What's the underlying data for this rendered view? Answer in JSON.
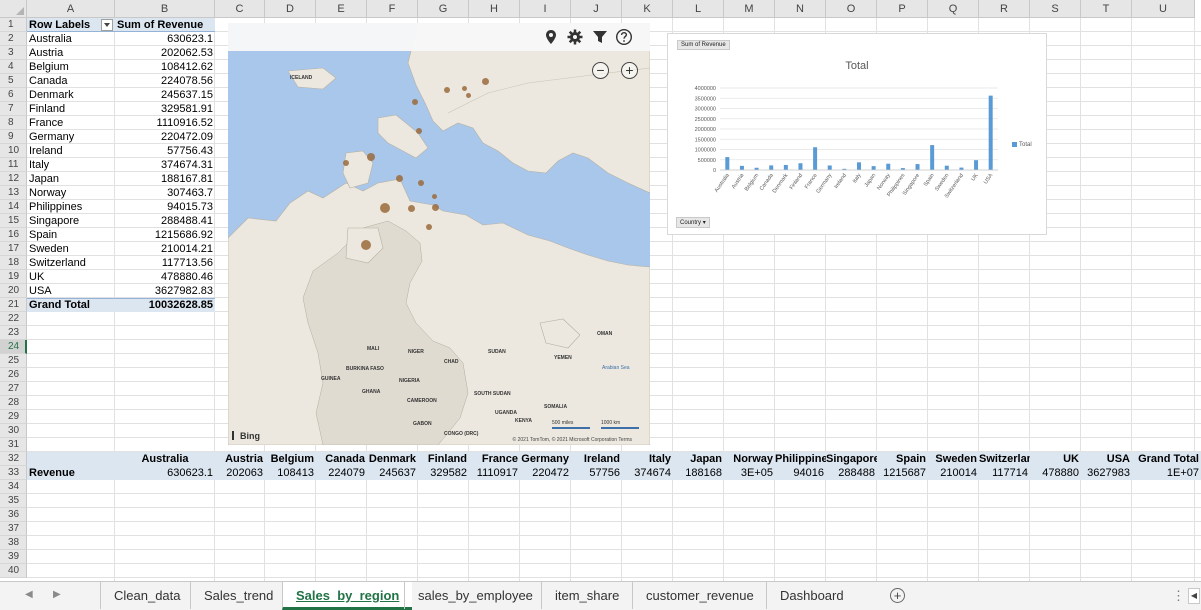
{
  "columns": [
    "A",
    "B",
    "C",
    "D",
    "E",
    "F",
    "G",
    "H",
    "I",
    "J",
    "K",
    "L",
    "M",
    "N",
    "O",
    "P",
    "Q",
    "R",
    "S",
    "T",
    "U"
  ],
  "rows": [
    "1",
    "2",
    "3",
    "4",
    "5",
    "6",
    "7",
    "8",
    "9",
    "10",
    "11",
    "12",
    "13",
    "14",
    "15",
    "16",
    "17",
    "18",
    "19",
    "20",
    "21",
    "22",
    "23",
    "24",
    "25",
    "26",
    "27",
    "28",
    "29",
    "30",
    "31",
    "32",
    "33",
    "34",
    "35",
    "36",
    "37",
    "38",
    "39",
    "40"
  ],
  "active_row": "24",
  "pivot": {
    "row_labels_header": "Row Labels",
    "sum_header": "Sum of Revenue",
    "rows": [
      {
        "label": "Australia",
        "value": "630623.1"
      },
      {
        "label": "Austria",
        "value": "202062.53"
      },
      {
        "label": "Belgium",
        "value": "108412.62"
      },
      {
        "label": "Canada",
        "value": "224078.56"
      },
      {
        "label": "Denmark",
        "value": "245637.15"
      },
      {
        "label": "Finland",
        "value": "329581.91"
      },
      {
        "label": "France",
        "value": "1110916.52"
      },
      {
        "label": "Germany",
        "value": "220472.09"
      },
      {
        "label": "Ireland",
        "value": "57756.43"
      },
      {
        "label": "Italy",
        "value": "374674.31"
      },
      {
        "label": "Japan",
        "value": "188167.81"
      },
      {
        "label": "Norway",
        "value": "307463.7"
      },
      {
        "label": "Philippines",
        "value": "94015.73"
      },
      {
        "label": "Singapore",
        "value": "288488.41"
      },
      {
        "label": "Spain",
        "value": "1215686.92"
      },
      {
        "label": "Sweden",
        "value": "210014.21"
      },
      {
        "label": "Switzerland",
        "value": "117713.56"
      },
      {
        "label": "UK",
        "value": "478880.46"
      },
      {
        "label": "USA",
        "value": "3627982.83"
      }
    ],
    "grand_total_label": "Grand Total",
    "grand_total_value": "10032628.85"
  },
  "horizontal_table": {
    "row_label": "Revenue",
    "headers": [
      "Australia",
      "Austria",
      "Belgium",
      "Canada",
      "Denmark",
      "Finland",
      "France",
      "Germany",
      "Ireland",
      "Italy",
      "Japan",
      "Norway",
      "Philippines",
      "Singapore",
      "Spain",
      "Sweden",
      "Switzerland",
      "UK",
      "USA",
      "Grand Total"
    ],
    "values": [
      "630623.1",
      "202063",
      "108413",
      "224079",
      "245637",
      "329582",
      "1110917",
      "220472",
      "57756",
      "374674",
      "188168",
      "3E+05",
      "94016",
      "288488",
      "1215687",
      "210014",
      "117714",
      "478880",
      "3627983",
      "1E+07"
    ]
  },
  "map": {
    "labels": [
      {
        "text": "ICELAND",
        "id": "iceland"
      },
      {
        "text": "OMAN",
        "id": "oman"
      },
      {
        "text": "MALI",
        "id": "mali"
      },
      {
        "text": "NIGER",
        "id": "niger"
      },
      {
        "text": "SUDAN",
        "id": "sudan"
      },
      {
        "text": "CHAD",
        "id": "chad"
      },
      {
        "text": "YEMEN",
        "id": "yemen"
      },
      {
        "text": "BURKINA FASO",
        "id": "burkina"
      },
      {
        "text": "GUINEA",
        "id": "guinea"
      },
      {
        "text": "NIGERIA",
        "id": "nigeria"
      },
      {
        "text": "GHANA",
        "id": "ghana"
      },
      {
        "text": "CAMEROON",
        "id": "cameroon"
      },
      {
        "text": "SOUTH SUDAN",
        "id": "ssudan"
      },
      {
        "text": "SOMALIA",
        "id": "somalia"
      },
      {
        "text": "UGANDA",
        "id": "uganda"
      },
      {
        "text": "KENYA",
        "id": "kenya"
      },
      {
        "text": "GABON",
        "id": "gabon"
      },
      {
        "text": "CONGO (DRC)",
        "id": "congo"
      }
    ],
    "sea_label": "Arabian Sea",
    "brand": "Bing",
    "attribution": "© 2021 TomTom, © 2021 Microsoft Corporation  Terms",
    "scale_miles": "500 miles",
    "scale_km": "1000 km",
    "zoom_out": "−",
    "zoom_in": "+"
  },
  "chart": {
    "field_button": "Sum of Revenue",
    "axis_button": "Country",
    "legend_label": "Total"
  },
  "chart_data": {
    "type": "bar",
    "title": "Total",
    "categories": [
      "Australia",
      "Austria",
      "Belgium",
      "Canada",
      "Denmark",
      "Finland",
      "France",
      "Germany",
      "Ireland",
      "Italy",
      "Japan",
      "Norway",
      "Philippines",
      "Singapore",
      "Spain",
      "Sweden",
      "Switzerland",
      "UK",
      "USA"
    ],
    "series": [
      {
        "name": "Total",
        "values": [
          630623.1,
          202062.53,
          108412.62,
          224078.56,
          245637.15,
          329581.91,
          1110916.52,
          220472.09,
          57756.43,
          374674.31,
          188167.81,
          307463.7,
          94015.73,
          288488.41,
          1215686.92,
          210014.21,
          117713.56,
          478880.46,
          3627982.83
        ]
      }
    ],
    "yticks": [
      "0",
      "500000",
      "1000000",
      "1500000",
      "2000000",
      "2500000",
      "3000000",
      "3500000",
      "4000000"
    ],
    "ylim": [
      0,
      4000000
    ],
    "grid": true,
    "legend_position": "right",
    "color": "#5b9bd5"
  },
  "sheet_tabs": [
    "Clean_data",
    "Sales_trend",
    "Sales_by_region",
    "sales_by_employee",
    "item_share",
    "customer_revenue",
    "Dashboard"
  ],
  "active_tab": "Sales_by_region",
  "tab_controls": {
    "add": "+",
    "more": "⋮",
    "scroll": "◀",
    "prev": "◀",
    "next": "▶"
  }
}
